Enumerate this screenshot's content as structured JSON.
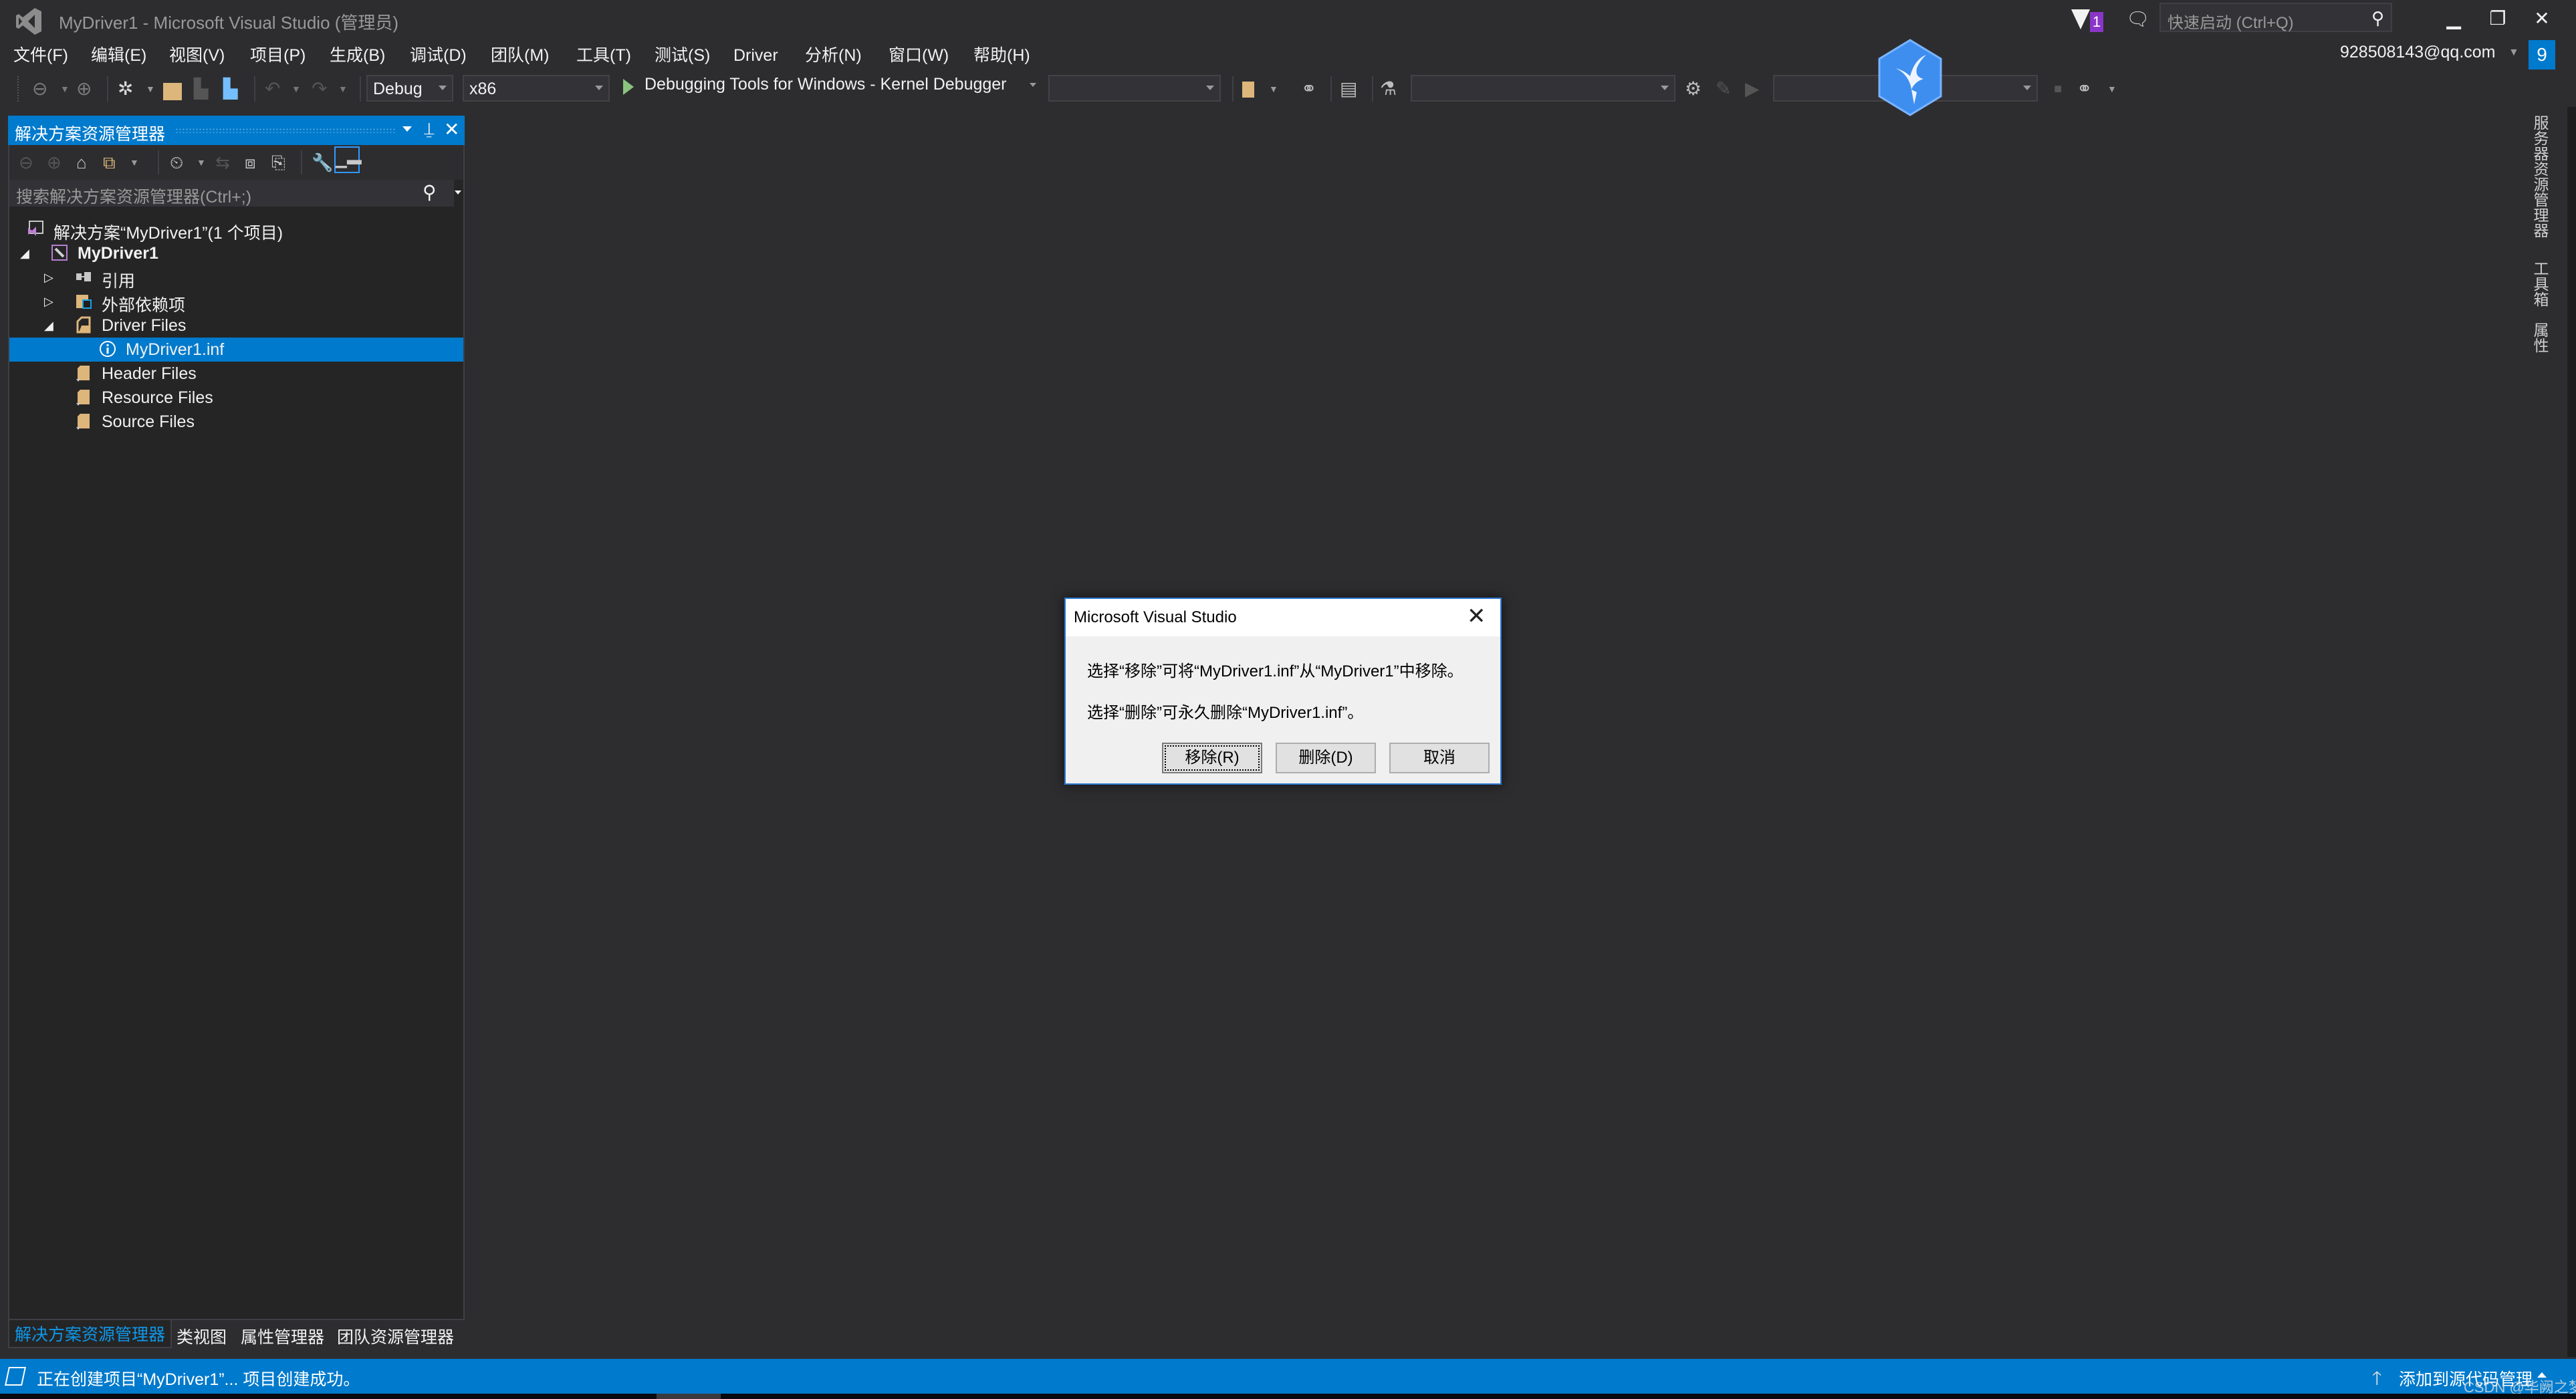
{
  "window": {
    "title": "MyDriver1 - Microsoft Visual Studio (管理员)",
    "notification_count": "1",
    "quick_launch_placeholder": "快速启动 (Ctrl+Q)",
    "minimize_glyph": "▁",
    "restore_glyph": "❐",
    "close_glyph": "✕",
    "account": "928508143@qq.com",
    "account_badge": "9"
  },
  "menu": [
    {
      "label": "文件(F)"
    },
    {
      "label": "编辑(E)"
    },
    {
      "label": "视图(V)"
    },
    {
      "label": "项目(P)"
    },
    {
      "label": "生成(B)"
    },
    {
      "label": "调试(D)"
    },
    {
      "label": "团队(M)"
    },
    {
      "label": "工具(T)"
    },
    {
      "label": "测试(S)"
    },
    {
      "label": "Driver"
    },
    {
      "label": "分析(N)"
    },
    {
      "label": "窗口(W)"
    },
    {
      "label": "帮助(H)"
    }
  ],
  "toolbar": {
    "configuration": "Debug",
    "platform": "x86",
    "debugger": "Debugging Tools for Windows - Kernel Debugger",
    "combo3": "",
    "combo4": "",
    "combo5": ""
  },
  "solution_explorer": {
    "title": "解决方案资源管理器",
    "search_placeholder": "搜索解决方案资源管理器(Ctrl+;)",
    "tree": [
      {
        "label": "解决方案“MyDriver1”(1 个项目)",
        "level": 0,
        "expander": "",
        "icon": "solution"
      },
      {
        "label": "MyDriver1",
        "level": 0,
        "expander": "◢",
        "icon": "project",
        "bold": true
      },
      {
        "label": "引用",
        "level": 1,
        "expander": "▷",
        "icon": "references"
      },
      {
        "label": "外部依赖项",
        "level": 1,
        "expander": "▷",
        "icon": "external-deps"
      },
      {
        "label": "Driver Files",
        "level": 1,
        "expander": "◢",
        "icon": "filter-folder-open"
      },
      {
        "label": "MyDriver1.inf",
        "level": 2,
        "expander": "",
        "icon": "info",
        "selected": true
      },
      {
        "label": "Header Files",
        "level": 1,
        "expander": "",
        "icon": "filter-folder"
      },
      {
        "label": "Resource Files",
        "level": 1,
        "expander": "",
        "icon": "filter-folder"
      },
      {
        "label": "Source Files",
        "level": 1,
        "expander": "",
        "icon": "filter-folder"
      }
    ]
  },
  "bottom_tabs": [
    {
      "label": "解决方案资源管理器",
      "active": true
    },
    {
      "label": "类视图"
    },
    {
      "label": "属性管理器"
    },
    {
      "label": "团队资源管理器"
    }
  ],
  "right_tabs": [
    {
      "label": "服务器资源管理器"
    },
    {
      "label": "工具箱"
    },
    {
      "label": "属性"
    }
  ],
  "status": {
    "message": "正在创建项目“MyDriver1”... 项目创建成功。",
    "source_control": "添加到源代码管理"
  },
  "watermark": "CSDN @华阙之梦",
  "dialog": {
    "title": "Microsoft Visual Studio",
    "line1": "选择“移除”可将“MyDriver1.inf”从“MyDriver1”中移除。",
    "line2": "选择“删除”可永久删除“MyDriver1.inf”。",
    "buttons": {
      "remove": "移除(R)",
      "delete": "删除(D)",
      "cancel": "取消"
    }
  }
}
